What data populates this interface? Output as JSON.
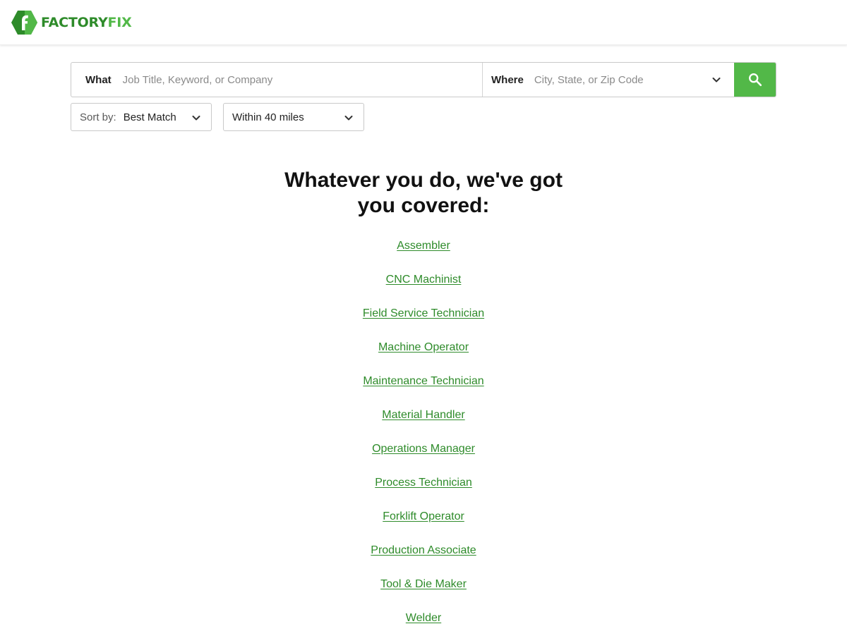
{
  "header": {
    "logo": {
      "text_part1": "FACTORY",
      "text_part2": "FIX",
      "icon": "factoryfix-logo-mark"
    },
    "colors": {
      "brand_dark": "#2e8b2a",
      "brand_green": "#52b848"
    }
  },
  "search": {
    "what_label": "What",
    "what_placeholder": "Job Title, Keyword, or Company",
    "what_value": "",
    "where_label": "Where",
    "where_placeholder": "City, State, or Zip Code",
    "where_value": "",
    "where_icon": "chevron-down-icon",
    "button_icon": "search-icon"
  },
  "filters": {
    "sort_label": "Sort by:",
    "sort_value": "Best Match",
    "radius_value": "Within 40 miles"
  },
  "content": {
    "headline_line1": "Whatever you do, we've got",
    "headline_line2": "you covered:",
    "categories": [
      "Assembler",
      "CNC Machinist",
      "Field Service Technician",
      "Machine Operator",
      "Maintenance Technician",
      "Material Handler",
      "Operations Manager",
      "Process Technician",
      "Forklift Operator",
      "Production Associate",
      "Tool & Die Maker",
      "Welder"
    ]
  }
}
